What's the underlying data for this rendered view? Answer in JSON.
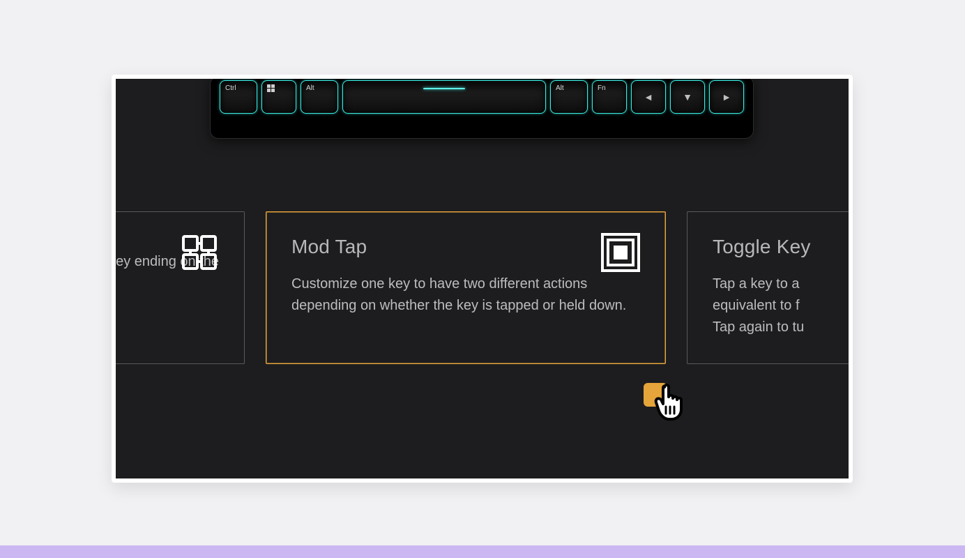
{
  "keyboard": {
    "keys": [
      {
        "label": "Ctrl",
        "cls": "mod"
      },
      {
        "label": "",
        "cls": "small",
        "icon": "win"
      },
      {
        "label": "Alt",
        "cls": "mod"
      },
      {
        "label": "",
        "cls": "space"
      },
      {
        "label": "Alt",
        "cls": "mod"
      },
      {
        "label": "Fn",
        "cls": "small"
      },
      {
        "label": "◄",
        "cls": "arrow"
      },
      {
        "label": "▼",
        "cls": "arrow"
      },
      {
        "label": "►",
        "cls": "arrow"
      }
    ]
  },
  "cards": {
    "left": {
      "title": "",
      "desc": "for a single key ending on the",
      "icon": "multi-key"
    },
    "mid": {
      "title": "Mod Tap",
      "desc": "Customize one key to have two different actions depending on whether the key is tapped or held down.",
      "icon": "nested-square"
    },
    "right": {
      "title": "Toggle Key",
      "desc": "Tap a key to a­equivalent to f­Tap again to tu"
    }
  },
  "colors": {
    "accent": "#e6a53a",
    "glow": "#3befe5",
    "lavender": "#cbb7f2"
  }
}
